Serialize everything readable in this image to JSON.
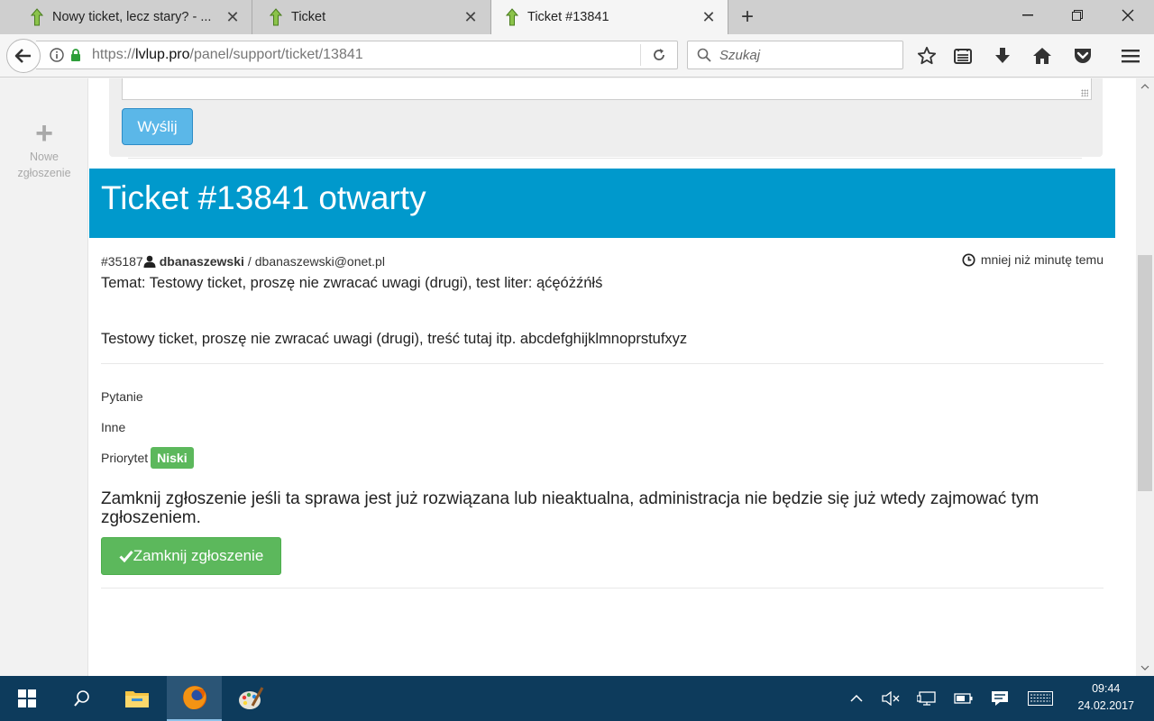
{
  "browser": {
    "tabs": [
      {
        "title": "Nowy ticket, lecz stary? - ...",
        "active": false
      },
      {
        "title": "Ticket",
        "active": false
      },
      {
        "title": "Ticket #13841",
        "active": true
      }
    ],
    "url_prefix": "https://",
    "url_host": "lvlup.pro",
    "url_path": "/panel/support/ticket/13841",
    "search_placeholder": "Szukaj"
  },
  "sidebar": {
    "new_ticket_line1": "Nowe",
    "new_ticket_line2": "zgłoszenie"
  },
  "reply": {
    "send_label": "Wyślij"
  },
  "ticket": {
    "header": "Ticket #13841 otwarty",
    "message_id": "#35187",
    "username": "dbanaszewski",
    "email": "dbanaszewski@onet.pl",
    "time": "mniej niż minutę temu",
    "subject": "Temat: Testowy ticket, proszę nie zwracać uwagi (drugi), test liter: ąćęóżźńłś",
    "content": "Testowy ticket, proszę nie zwracać uwagi (drugi), treść tutaj itp. abcdefghijklmnoprstufxyz",
    "category": "Pytanie",
    "subcategory": "Inne",
    "priority_label": "Priorytet",
    "priority_value": "Niski",
    "close_info": "Zamknij zgłoszenie jeśli ta sprawa jest już rozwiązana lub nieaktualna, administracja nie będzie się już wtedy zajmować tym zgłoszeniem.",
    "close_button": "Zamknij zgłoszenie"
  },
  "taskbar": {
    "time": "09:44",
    "date": "24.02.2017"
  },
  "colors": {
    "header_bg": "#0099cc",
    "success": "#5cb85c",
    "send_button": "#5bb7e8",
    "taskbar": "#0d3b5c"
  },
  "icons": [
    "lvlup-favicon",
    "close-icon",
    "plus-icon",
    "minimize-icon",
    "restore-icon",
    "back-arrow-icon",
    "info-icon",
    "lock-icon",
    "reload-icon",
    "search-icon",
    "star-icon",
    "reading-list-icon",
    "download-icon",
    "home-icon",
    "pocket-icon",
    "hamburger-menu-icon",
    "user-icon",
    "clock-icon",
    "check-icon",
    "windows-start-icon",
    "search-taskbar-icon",
    "file-explorer-icon",
    "firefox-icon",
    "paint-icon",
    "chevron-up-icon",
    "volume-muted-icon",
    "network-icon",
    "battery-icon",
    "notification-icon",
    "keyboard-icon"
  ]
}
